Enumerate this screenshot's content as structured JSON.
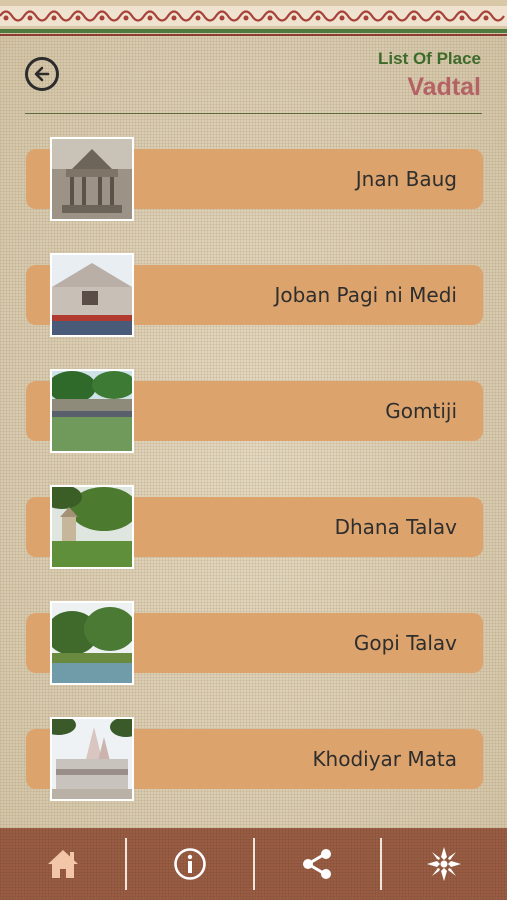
{
  "header": {
    "back_icon": "back-arrow-icon",
    "subtitle": "List Of Place",
    "title": "Vadtal"
  },
  "places": [
    {
      "name": "Jnan Baug",
      "thumb": "pavilion-photo"
    },
    {
      "name": "Joban Pagi ni Medi",
      "thumb": "house-photo"
    },
    {
      "name": "Gomtiji",
      "thumb": "lake-crowd-photo"
    },
    {
      "name": "Dhana Talav",
      "thumb": "garden-pavilion-photo"
    },
    {
      "name": "Gopi Talav",
      "thumb": "lake-trees-photo"
    },
    {
      "name": "Khodiyar Mata",
      "thumb": "temple-photo"
    }
  ],
  "bottom_nav": {
    "items": [
      "home-icon",
      "info-icon",
      "share-icon",
      "settings-icon"
    ]
  },
  "colors": {
    "item_bar": "#dca36c",
    "subtitle": "#3d6b2a",
    "title": "#b56266",
    "nav_bg": "#9a5d44",
    "nav_icon": "#f3c6a8"
  }
}
